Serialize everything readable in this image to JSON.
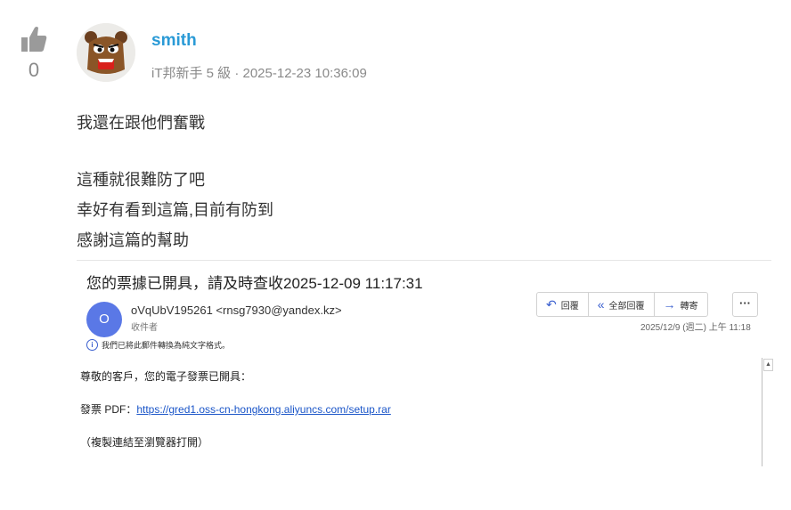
{
  "post": {
    "vote_count": "0",
    "author": "smith",
    "meta": "iT邦新手 5 級 · 2025-12-23 10:36:09",
    "lines_a": [
      "我還在跟他們奮戰"
    ],
    "lines_b": [
      "這種就很難防了吧",
      "幸好有看到這篇,目前有防到",
      "感謝這篇的幫助"
    ]
  },
  "email": {
    "subject": "您的票據已開具，請及時查收2025-12-09 11:17:31",
    "sender_initial": "O",
    "sender": "oVqUbV195261 <rnsg7930@yandex.kz>",
    "recipient_label": "收件者",
    "actions": [
      {
        "icon": "reply-icon",
        "glyph": "↶",
        "label": "回覆"
      },
      {
        "icon": "reply-all-icon",
        "glyph": "«",
        "label": "全部回覆"
      },
      {
        "icon": "forward-icon",
        "glyph": "→",
        "label": "轉寄"
      }
    ],
    "more_label": "···",
    "date": "2025/12/9 (週二) 上午 11:18",
    "notice": "我們已將此郵件轉換為純文字格式。",
    "body": {
      "greeting": "尊敬的客戶，您的電子發票已開具：",
      "invoice_prefix": "發票 PDF：",
      "link": "https://gred1.oss-cn-hongkong.aliyuncs.com/setup.rar",
      "instruction": "（複製連結至瀏覽器打開）"
    }
  },
  "colors": {
    "accent": "#2a9ad6",
    "sender_avatar": "#5a78e6",
    "link": "#1a55c8"
  }
}
